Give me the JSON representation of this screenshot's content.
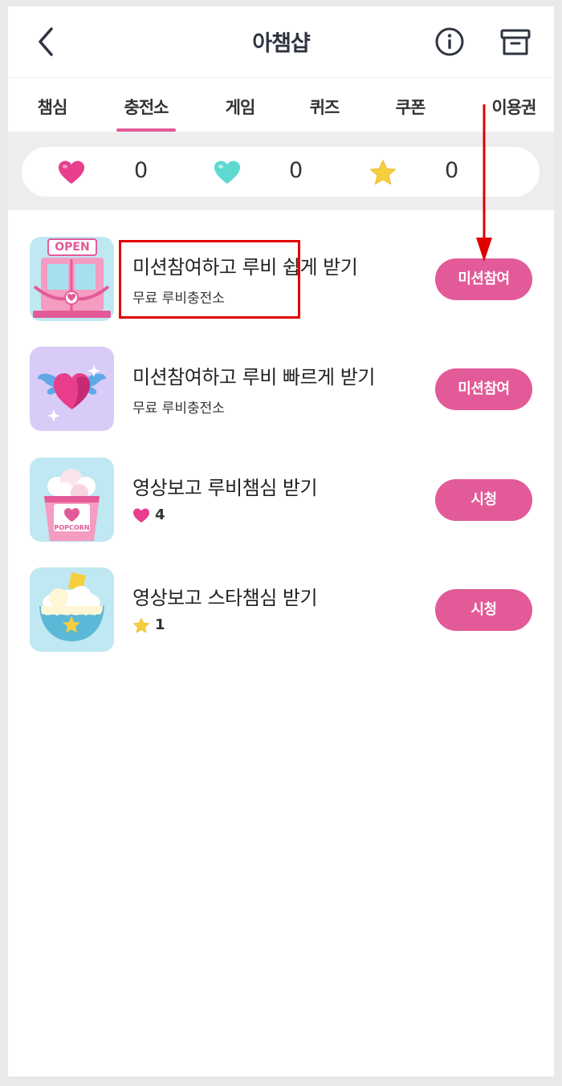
{
  "header": {
    "title": "아챔샵",
    "back_icon": "chevron-left-icon",
    "info_icon": "info-circle-icon",
    "archive_icon": "archive-box-icon"
  },
  "tabs": [
    {
      "label": "챔심"
    },
    {
      "label": "충전소",
      "active": true
    },
    {
      "label": "게임"
    },
    {
      "label": "퀴즈"
    },
    {
      "label": "쿠폰"
    },
    {
      "label": "이용권"
    }
  ],
  "balance": {
    "heart_pink": "0",
    "heart_teal": "0",
    "star": "0"
  },
  "items": [
    {
      "title": "미션참여하고 루비 쉽게 받기",
      "subtitle": "무료 루비충전소",
      "button": "미션참여",
      "thumb_icon": "open-store-icon"
    },
    {
      "title": "미션참여하고 루비 빠르게 받기",
      "subtitle": "무료 루비충전소",
      "button": "미션참여",
      "thumb_icon": "winged-heart-icon"
    },
    {
      "title": "영상보고 루비챔심 받기",
      "reward_icon": "heart-icon",
      "reward": "4",
      "button": "시청",
      "thumb_icon": "popcorn-icon",
      "thumb_text": "POPCORN"
    },
    {
      "title": "영상보고 스타챔심 받기",
      "reward_icon": "star-icon",
      "reward": "1",
      "button": "시청",
      "thumb_icon": "star-bowl-icon"
    }
  ],
  "thumbs": {
    "open_sign": "OPEN"
  },
  "colors": {
    "accent": "#e35a98",
    "heart_pink": "#e83e8c",
    "heart_teal": "#5fd9d0",
    "star": "#f6cf3e",
    "annotation": "#e00000"
  }
}
